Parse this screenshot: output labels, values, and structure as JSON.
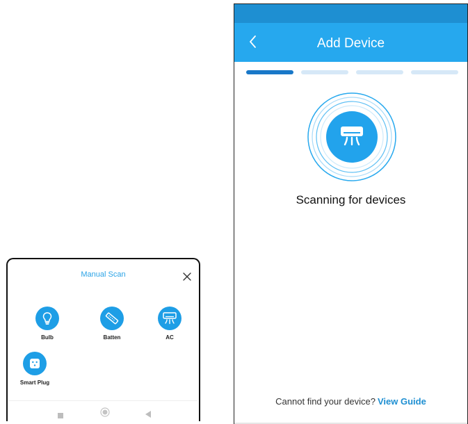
{
  "manual_scan": {
    "title": "Manual Scan",
    "close_icon": "close-icon",
    "devices": [
      {
        "label": "Bulb",
        "icon": "bulb-icon"
      },
      {
        "label": "Batten",
        "icon": "batten-icon"
      },
      {
        "label": "AC",
        "icon": "ac-icon"
      },
      {
        "label": "Smart Plug",
        "icon": "smart-plug-icon"
      }
    ],
    "nav": [
      "recent-apps-icon",
      "home-icon",
      "back-icon"
    ]
  },
  "add_device": {
    "title": "Add Device",
    "back_icon": "chevron-left-icon",
    "steps_total": 4,
    "current_step": 1,
    "scan_icon": "ac-icon",
    "status": "Scanning for devices",
    "footer_text": "Cannot find your device?",
    "footer_link": "View Guide"
  },
  "colors": {
    "accent": "#26a8ee",
    "status_bar": "#1e8fd2",
    "active_step": "#1978c8",
    "inactive_step": "#d6e8f7",
    "link": "#1e8fd2"
  }
}
